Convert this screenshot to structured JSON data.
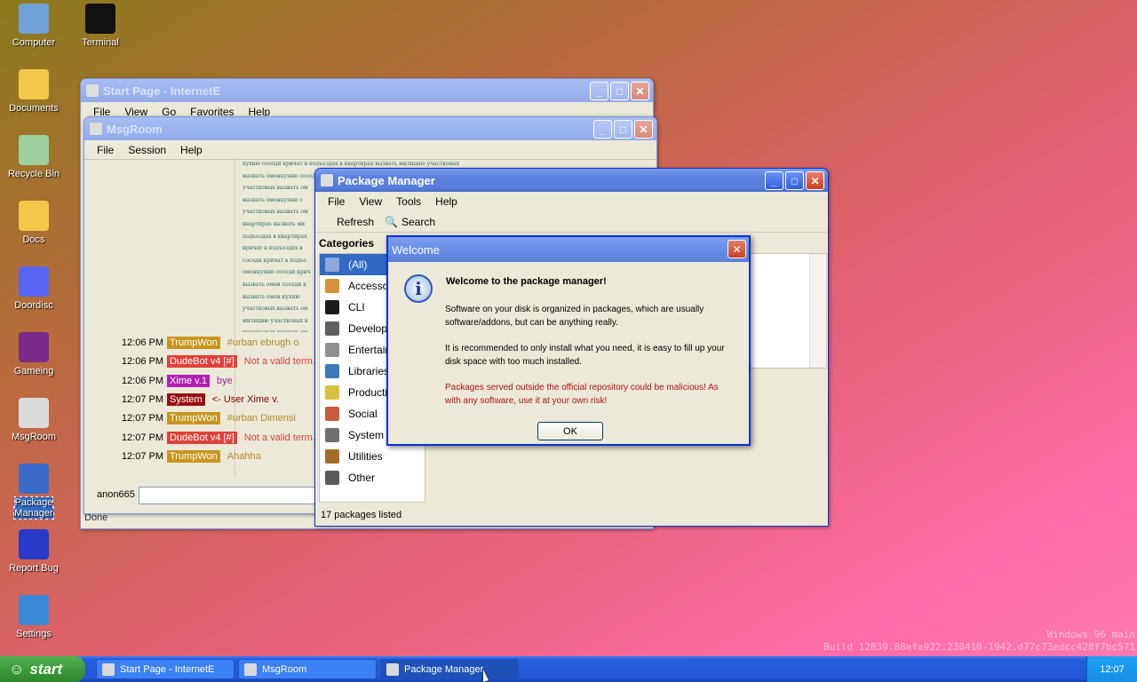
{
  "desktop": {
    "icons": [
      {
        "label": "Computer",
        "icon": "computer-icon",
        "color": "#6fa2d8"
      },
      {
        "label": "Terminal",
        "icon": "terminal-icon",
        "color": "#111111"
      },
      {
        "label": "Documents",
        "icon": "documents-icon",
        "color": "#f2c84b"
      },
      {
        "label": "Recycle Bin",
        "icon": "recycle-bin-icon",
        "color": "#9fd0a0"
      },
      {
        "label": "Docs",
        "icon": "folder-icon",
        "color": "#f2c84b"
      },
      {
        "label": "Doordisc",
        "icon": "doordisc-icon",
        "color": "#5865f2"
      },
      {
        "label": "Gameing",
        "icon": "game-cube-icon",
        "color": "#7a2a8a"
      },
      {
        "label": "MsgRoom",
        "icon": "msgroom-icon",
        "color": "#dcdcdc"
      },
      {
        "label": "Package Manager",
        "icon": "package-manager-icon",
        "color": "#3a6ac8"
      },
      {
        "label": "Report Bug",
        "icon": "report-bug-icon",
        "color": "#2a3ac8"
      },
      {
        "label": "Settings",
        "icon": "settings-icon",
        "color": "#3a8ad8"
      }
    ]
  },
  "ie": {
    "title": "Start Page - InternetE",
    "menu": [
      "File",
      "View",
      "Go",
      "Favorites",
      "Help"
    ],
    "status": "Done"
  },
  "msgroom": {
    "title": "MsgRoom",
    "menu": [
      "File",
      "Session",
      "Help"
    ],
    "username": "anon665",
    "rows": [
      {
        "time": "12:06 PM",
        "nick": "TrumpWon",
        "nick_color": "#c8951e",
        "text": "#urban ebrugh o",
        "text_color": "#b08a2a"
      },
      {
        "time": "12:06 PM",
        "nick": "DudeBot v4 [#]",
        "nick_color": "#e0413a",
        "text": "Not a valid term.",
        "text_color": "#d84040"
      },
      {
        "time": "12:06 PM",
        "nick": "Xime v.1",
        "nick_color": "#b01fb0",
        "text": "bye",
        "text_color": "#a020a0"
      },
      {
        "time": "12:07 PM",
        "nick": "System",
        "nick_color": "#9a1010",
        "text": "<- User Xime v.",
        "text_color": "#8a0000"
      },
      {
        "time": "12:07 PM",
        "nick": "TrumpWon",
        "nick_color": "#c8951e",
        "text": "#urban Dimensi",
        "text_color": "#b08a2a"
      },
      {
        "time": "12:07 PM",
        "nick": "DudeBot v4 [#]",
        "nick_color": "#e0413a",
        "text": "Not a valid term.",
        "text_color": "#d84040"
      },
      {
        "time": "12:07 PM",
        "nick": "TrumpWon",
        "nick_color": "#c8951e",
        "text": "Ahahha",
        "text_color": "#b08a2a"
      }
    ],
    "bg_text": [
      "кухню соседи кричат в подъездах в квартирах вызвать милицию участковых",
      "вызвать омонкухню соседи",
      "участковых вызвать ом",
      "вызвать омонкухню с",
      "участковых вызвать ом",
      "квартирах вызвать ми",
      "подъездах в квартирах",
      "кричат в подъездах в",
      "соседи кричат в подъе",
      "омонкухню соседи крич",
      "вызвать омон соседи к",
      "вызвать омон кухню",
      "участковых вызвать ом",
      "милицию участковых в",
      "участковых вызвать ом"
    ]
  },
  "pkg": {
    "title": "Package Manager",
    "menu": [
      "File",
      "View",
      "Tools",
      "Help"
    ],
    "toolbar": {
      "refresh": "Refresh",
      "search": "Search"
    },
    "categories_header": "Categories",
    "categories": [
      {
        "label": "(All)",
        "icon": "all-icon",
        "color": "#8fa8d8"
      },
      {
        "label": "Accessor",
        "icon": "accessories-icon",
        "color": "#d8903a"
      },
      {
        "label": "CLI",
        "icon": "cli-icon",
        "color": "#1a1a1a"
      },
      {
        "label": "Developm",
        "icon": "development-icon",
        "color": "#606060"
      },
      {
        "label": "Entertainm",
        "icon": "entertainment-icon",
        "color": "#909090"
      },
      {
        "label": "Libraries",
        "icon": "libraries-icon",
        "color": "#3a7ab8"
      },
      {
        "label": "Productiv",
        "icon": "productivity-icon",
        "color": "#d8c040"
      },
      {
        "label": "Social",
        "icon": "social-icon",
        "color": "#c85a3a"
      },
      {
        "label": "System",
        "icon": "system-icon",
        "color": "#707070"
      },
      {
        "label": "Utilities",
        "icon": "utilities-icon",
        "color": "#a86a2a"
      },
      {
        "label": "Other",
        "icon": "other-icon",
        "color": "#5a5a5a"
      }
    ],
    "status": "17 packages listed"
  },
  "dialog": {
    "title": "Welcome",
    "heading": "Welcome to the package manager!",
    "p1": "Software on your disk is organized in packages, which are usually software/addons, but can be anything really.",
    "p2": "It is recommended to only install what you need, it is easy to fill up your disk space with too much installed.",
    "p3": "Packages served outside the official repository could be malicious! As with any software, use it at your own risk!",
    "ok": "OK",
    "warn_color": "#b01010"
  },
  "taskbar": {
    "start": "start",
    "tasks": [
      "Start Page - InternetE",
      "MsgRoom",
      "Package Manager"
    ],
    "clock": "12:07"
  },
  "watermark": {
    "line1": "Windows 96 main",
    "line2": "Build 12839.88efa922.230410-1942.d77c73edcc428f7bc571"
  }
}
